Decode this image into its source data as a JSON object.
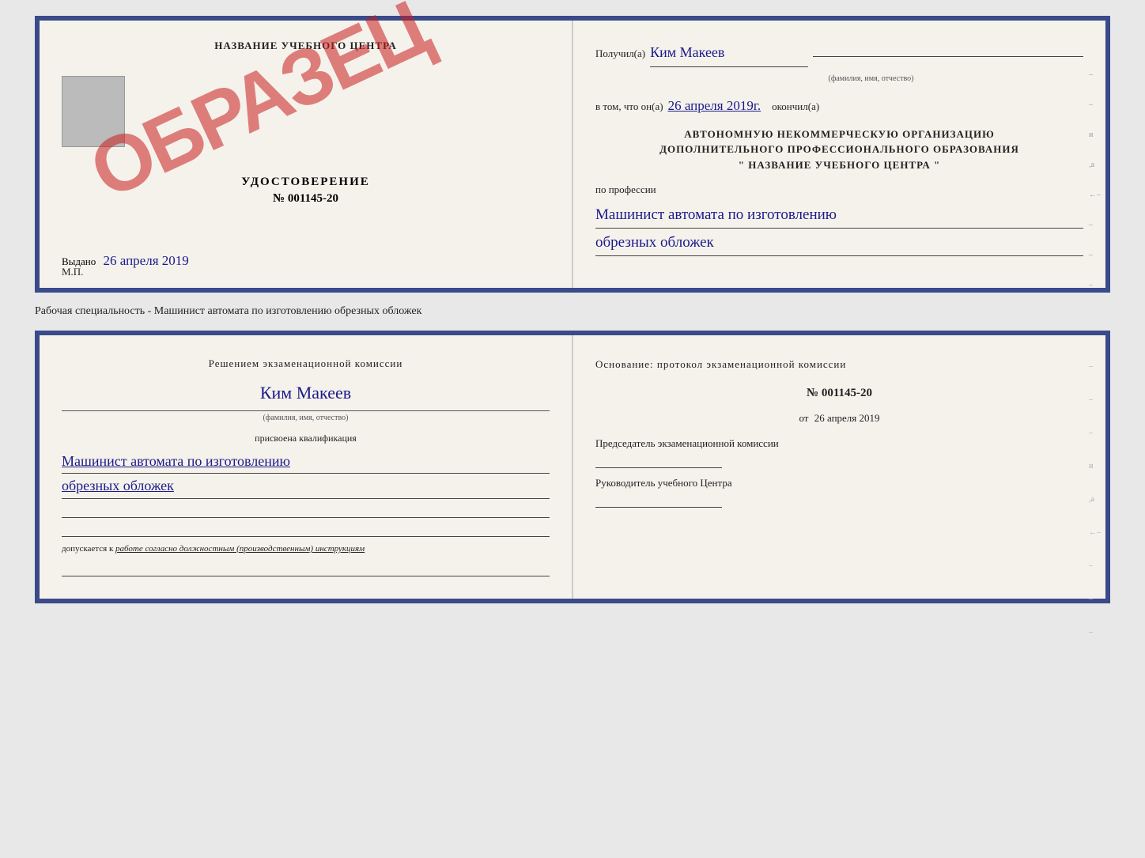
{
  "top_document": {
    "left": {
      "school_name": "НАЗВАНИЕ УЧЕБНОГО ЦЕНТРА",
      "cert_title": "УДОСТОВЕРЕНИЕ",
      "cert_number": "№ 001145-20",
      "stamp": "ОБРАЗЕЦ",
      "issued_label": "Выдано",
      "issued_date": "26 апреля 2019",
      "mp_label": "М.П."
    },
    "right": {
      "received_label": "Получил(а)",
      "received_name": "Ким Макеев",
      "fio_sub": "(фамилия, имя, отчество)",
      "in_that_label": "в том, что он(а)",
      "date_value": "26 апреля 2019г.",
      "finished_label": "окончил(а)",
      "org_line1": "АВТОНОМНУЮ НЕКОММЕРЧЕСКУЮ ОРГАНИЗАЦИЮ",
      "org_line2": "ДОПОЛНИТЕЛЬНОГО ПРОФЕССИОНАЛЬНОГО ОБРАЗОВАНИЯ",
      "org_line3": "\"  НАЗВАНИЕ УЧЕБНОГО ЦЕНТРА  \"",
      "profession_label": "по профессии",
      "profession_value1": "Машинист автомата по изготовлению",
      "profession_value2": "обрезных обложек"
    }
  },
  "middle": {
    "label": "Рабочая специальность - Машинист автомата по изготовлению обрезных обложек"
  },
  "bottom_document": {
    "left": {
      "commission_title": "Решением экзаменационной комиссии",
      "name_value": "Ким Макеев",
      "fio_sub": "(фамилия, имя, отчество)",
      "qualification_assigned": "присвоена квалификация",
      "qualification_value1": "Машинист автомата по изготовлению",
      "qualification_value2": "обрезных обложек",
      "допускается_label": "допускается к",
      "допускается_value": "работе согласно должностным (производственным) инструкциям"
    },
    "right": {
      "osnovaniye_label": "Основание: протокол экзаменационной комиссии",
      "protocol_number": "№ 001145-20",
      "date_prefix": "от",
      "date_value": "26 апреля 2019",
      "chairman_label": "Председатель экзаменационной комиссии",
      "leader_label": "Руководитель учебного Центра"
    }
  }
}
